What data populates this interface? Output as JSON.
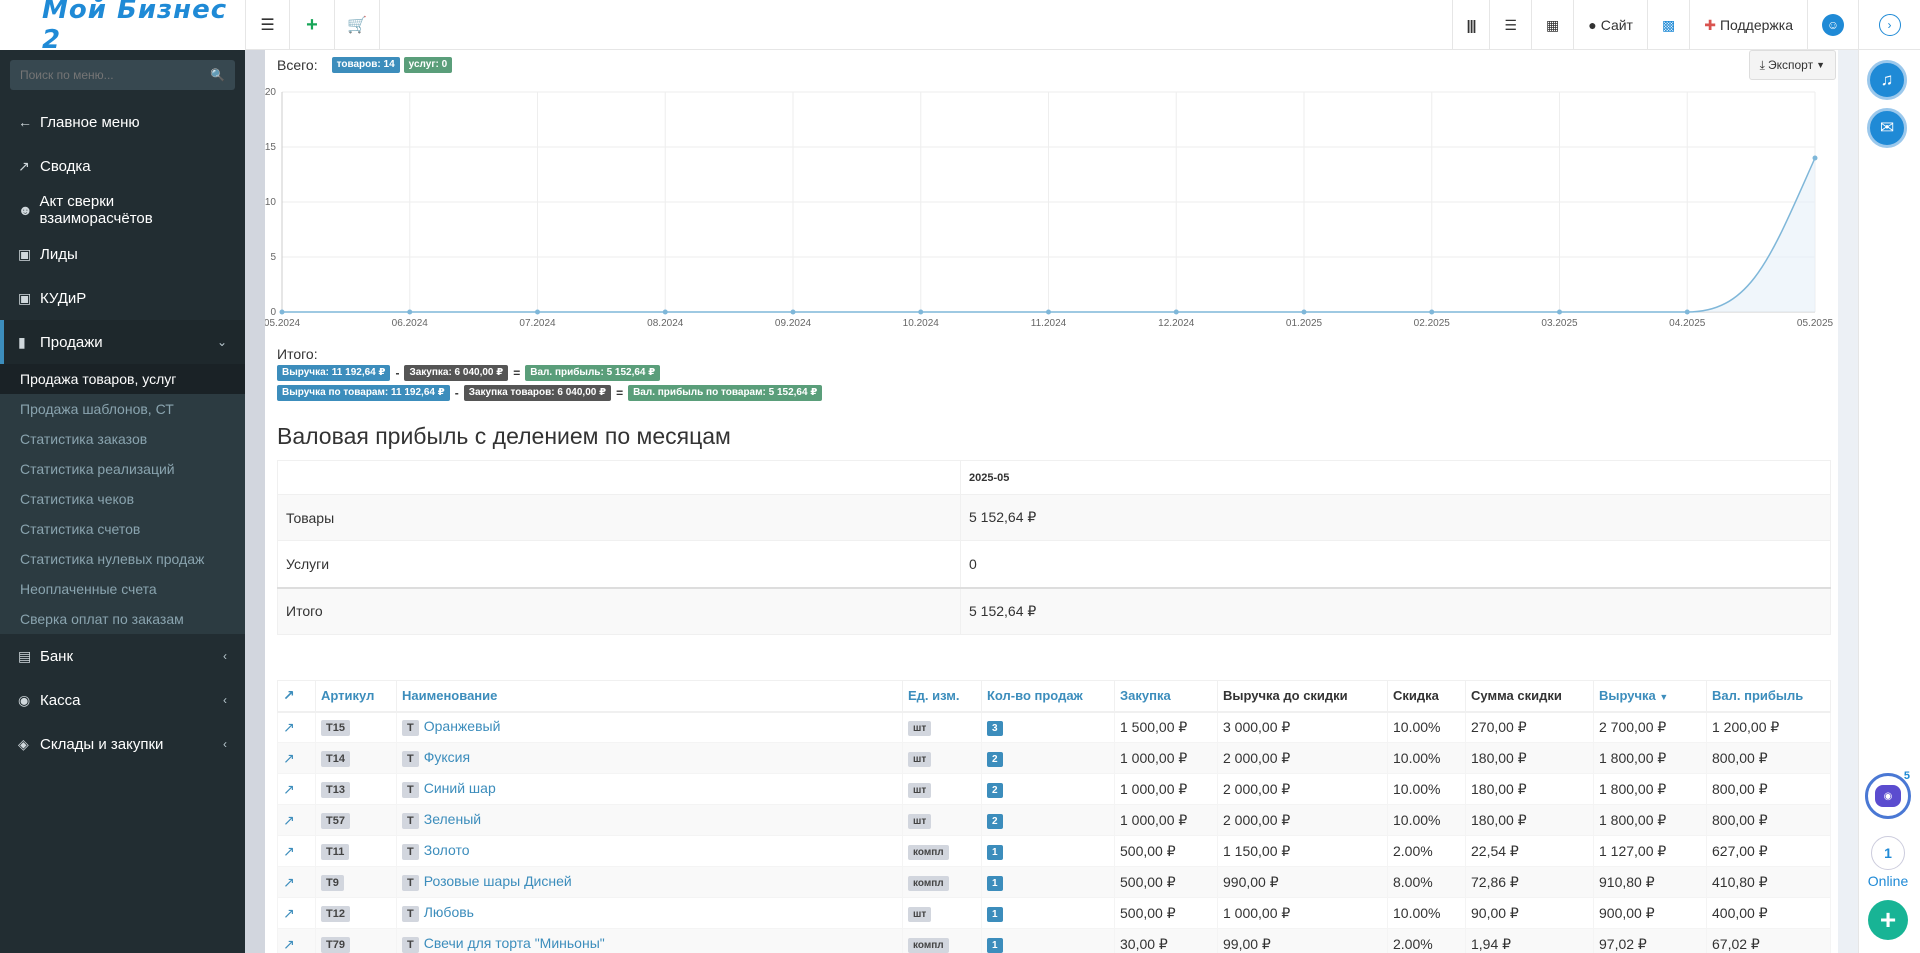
{
  "header": {
    "logo_text": "Мой Бизнес 2",
    "site_label": "Сайт",
    "support_label": "Поддержка"
  },
  "sidebar": {
    "search_placeholder": "Поиск по меню...",
    "items": [
      {
        "label": "Главное меню",
        "icon": "arrow-left-icon"
      },
      {
        "label": "Сводка",
        "icon": "line-chart-icon"
      },
      {
        "label": "Акт сверки взаиморасчётов",
        "icon": "users-icon"
      },
      {
        "label": "Лиды",
        "icon": "contact-card-icon"
      },
      {
        "label": "КУДиР",
        "icon": "contact-card-icon"
      },
      {
        "label": "Продажи",
        "icon": "bar-chart-icon"
      }
    ],
    "sales_sub": [
      "Продажа товаров, услуг",
      "Продажа шаблонов, СТ",
      "Статистика заказов",
      "Статистика реализаций",
      "Статистика чеков",
      "Статистика счетов",
      "Статистика нулевых продаж",
      "Неоплаченные счета",
      "Сверка оплат по заказам"
    ],
    "bottom_items": [
      {
        "label": "Банк",
        "icon": "credit-card-icon"
      },
      {
        "label": "Касса",
        "icon": "money-icon"
      },
      {
        "label": "Склады и закупки",
        "icon": "cube-icon"
      }
    ]
  },
  "summary": {
    "total_label": "Всего:",
    "goods_badge": "товаров: 14",
    "services_badge": "услуг: 0",
    "export_label": "Экспорт"
  },
  "chart_data": {
    "type": "area",
    "x": [
      "05.2024",
      "06.2024",
      "07.2024",
      "08.2024",
      "09.2024",
      "10.2024",
      "11.2024",
      "12.2024",
      "01.2025",
      "02.2025",
      "03.2025",
      "04.2025",
      "05.2025"
    ],
    "series": [
      {
        "values": [
          0,
          0,
          0,
          0,
          0,
          0,
          0,
          0,
          0,
          0,
          0,
          0,
          14
        ],
        "color": "#7fb7d9"
      }
    ],
    "yticks": [
      0,
      5,
      10,
      15,
      20
    ],
    "ylim": [
      0,
      20
    ],
    "grid": true
  },
  "itogo": {
    "label": "Итого:",
    "row1": {
      "revenue": "Выручка: 11 192,64 ₽",
      "purchase": "Закупка: 6 040,00 ₽",
      "profit": "Вал. прибыль: 5 152,64 ₽"
    },
    "row2": {
      "revenue": "Выручка по товарам: 11 192,64 ₽",
      "purchase": "Закупка товаров: 6 040,00 ₽",
      "profit": "Вал. прибыль по товарам: 5 152,64 ₽"
    },
    "minus": "-",
    "equals": "="
  },
  "gross_profit": {
    "title": "Валовая прибыль с делением по месяцам",
    "month": "2025-05",
    "rows": [
      {
        "label": "Товары",
        "value": "5 152,64 ₽"
      },
      {
        "label": "Услуги",
        "value": "0"
      },
      {
        "label": "Итого",
        "value": "5 152,64 ₽"
      }
    ]
  },
  "items_table": {
    "headers": {
      "article": "Артикул",
      "name": "Наименование",
      "unit": "Ед. изм.",
      "qty": "Кол-во продаж",
      "purchase": "Закупка",
      "revenue_before": "Выручка до скидки",
      "discount": "Скидка",
      "discount_sum": "Сумма скидки",
      "revenue": "Выручка",
      "profit": "Вал. прибыль"
    },
    "type_tag": "Т",
    "rows": [
      {
        "art": "T15",
        "name": "Оранжевый",
        "unit": "шт",
        "qty": "3",
        "purchase": "1 500,00 ₽",
        "rev_before": "3 000,00 ₽",
        "discount": "10.00%",
        "disc_sum": "270,00 ₽",
        "revenue": "2 700,00 ₽",
        "profit": "1 200,00 ₽"
      },
      {
        "art": "T14",
        "name": "Фуксия",
        "unit": "шт",
        "qty": "2",
        "purchase": "1 000,00 ₽",
        "rev_before": "2 000,00 ₽",
        "discount": "10.00%",
        "disc_sum": "180,00 ₽",
        "revenue": "1 800,00 ₽",
        "profit": "800,00 ₽"
      },
      {
        "art": "T13",
        "name": "Синий шар",
        "unit": "шт",
        "qty": "2",
        "purchase": "1 000,00 ₽",
        "rev_before": "2 000,00 ₽",
        "discount": "10.00%",
        "disc_sum": "180,00 ₽",
        "revenue": "1 800,00 ₽",
        "profit": "800,00 ₽"
      },
      {
        "art": "T57",
        "name": "Зеленый",
        "unit": "шт",
        "qty": "2",
        "purchase": "1 000,00 ₽",
        "rev_before": "2 000,00 ₽",
        "discount": "10.00%",
        "disc_sum": "180,00 ₽",
        "revenue": "1 800,00 ₽",
        "profit": "800,00 ₽"
      },
      {
        "art": "T11",
        "name": "Золото",
        "unit": "компл",
        "qty": "1",
        "purchase": "500,00 ₽",
        "rev_before": "1 150,00 ₽",
        "discount": "2.00%",
        "disc_sum": "22,54 ₽",
        "revenue": "1 127,00 ₽",
        "profit": "627,00 ₽"
      },
      {
        "art": "T9",
        "name": "Розовые шары Дисней",
        "unit": "компл",
        "qty": "1",
        "purchase": "500,00 ₽",
        "rev_before": "990,00 ₽",
        "discount": "8.00%",
        "disc_sum": "72,86 ₽",
        "revenue": "910,80 ₽",
        "profit": "410,80 ₽"
      },
      {
        "art": "T12",
        "name": "Любовь",
        "unit": "шт",
        "qty": "1",
        "purchase": "500,00 ₽",
        "rev_before": "1 000,00 ₽",
        "discount": "10.00%",
        "disc_sum": "90,00 ₽",
        "revenue": "900,00 ₽",
        "profit": "400,00 ₽"
      },
      {
        "art": "T79",
        "name": "Свечи для торта \"Миньоны\"",
        "unit": "компл",
        "qty": "1",
        "purchase": "30,00 ₽",
        "rev_before": "99,00 ₽",
        "discount": "2.00%",
        "disc_sum": "1,94 ₽",
        "revenue": "97,02 ₽",
        "profit": "67,02 ₽"
      }
    ]
  },
  "rail": {
    "online_count": "1",
    "online_label": "Online",
    "bot_count": "5"
  }
}
